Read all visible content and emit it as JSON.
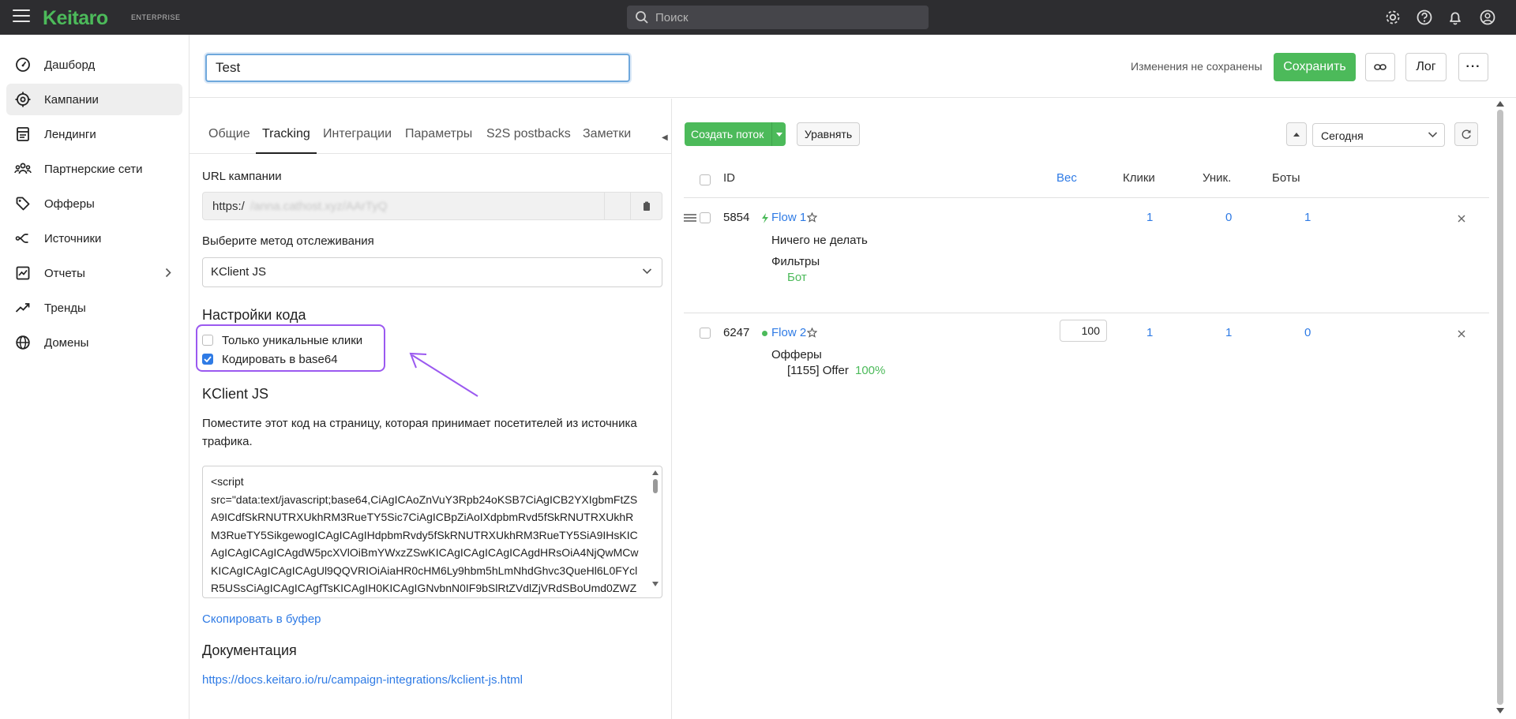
{
  "app": {
    "logo": "Keitaro",
    "edition": "ENTERPRISE",
    "search_placeholder": "Поиск"
  },
  "topbar_icons": [
    "gear-icon",
    "help-icon",
    "bell-icon",
    "user-icon"
  ],
  "sidebar": {
    "items": [
      {
        "label": "Дашборд",
        "icon": "dashboard-icon"
      },
      {
        "label": "Кампании",
        "icon": "target-icon"
      },
      {
        "label": "Лендинги",
        "icon": "landing-icon"
      },
      {
        "label": "Партнерские сети",
        "icon": "partners-icon"
      },
      {
        "label": "Офферы",
        "icon": "tag-icon"
      },
      {
        "label": "Источники",
        "icon": "source-icon"
      },
      {
        "label": "Отчеты",
        "icon": "report-icon"
      },
      {
        "label": "Тренды",
        "icon": "trend-icon"
      },
      {
        "label": "Домены",
        "icon": "globe-icon"
      }
    ]
  },
  "campaign": {
    "name": "Test",
    "unsaved_text": "Изменения не сохранены",
    "save_label": "Сохранить",
    "log_label": "Лог",
    "more_label": "···"
  },
  "tabs": [
    "Общие",
    "Tracking",
    "Интеграции",
    "Параметры",
    "S2S postbacks",
    "Заметки"
  ],
  "tracking": {
    "url_label": "URL кампании",
    "url_prefix": "https:/",
    "url_rest": "/anna.cathost.xyz/AArTyQ",
    "method_label": "Выберите метод отслеживания",
    "method_value": "KClient JS",
    "code_settings_title": "Настройки кода",
    "unique_clicks_label": "Только уникальные клики",
    "unique_clicks_checked": false,
    "base64_label": "Кодировать в base64",
    "base64_checked": true,
    "kclient_title": "KClient JS",
    "description": "Поместите этот код на страницу, которая принимает посетителей из источника трафика.",
    "code": "<script\nsrc=\"data:text/javascript;base64,CiAgICAoZnVuY3Rpb24oKSB7CiAgICB2YXIgbmFtZSA9ICdfSkRNUTRXUkhRM3RueTY5Sic7CiAgICBpZiAoIXdpbmRvd5fSkRNUTRXUkhRM3RueTY5SikgewogICAgICAgIHdpbmRvdy5fSkRNUTRXUkhRM3RueTY5SiA9IHsKICAgICAgICAgICAgdW5pcXVlOiBmYWxzZSwKICAgICAgICAgICAgdHRsOiA4NjQwMCwKICAgICAgICAgICAgUl9QQVRIOiAiaHR0cHM6Ly9hbm5hLmNhdGhvc3QueHl6L0FYclR5USsCiAgICAgICAgfTsKICAgIH0KICAgIGNvbnN0IF9bSlRtZVdlZjVRdSBoUmd0ZWZkD0xbOhVVwTdG9",
    "copy_label": "Скопировать в буфер",
    "docs_title": "Документация",
    "docs_link": "https://docs.keitaro.io/ru/campaign-integrations/kclient-js.html"
  },
  "flows_toolbar": {
    "create_label": "Создать поток",
    "align_label": "Уравнять",
    "date_value": "Сегодня"
  },
  "flows_table": {
    "headers": {
      "id": "ID",
      "weight": "Вес",
      "clicks": "Клики",
      "unique": "Уник.",
      "bots": "Боты"
    },
    "rows": [
      {
        "id": "5854",
        "name": "Flow 1",
        "action": "Ничего не делать",
        "section_title": "Фильтры",
        "section_item": "Бот",
        "weight": "",
        "clicks": "1",
        "unique": "0",
        "bots": "1"
      },
      {
        "id": "6247",
        "name": "Flow 2",
        "section_title": "Офферы",
        "section_item": "[1155] Offer",
        "section_share": "100%",
        "weight": "100",
        "clicks": "1",
        "unique": "1",
        "bots": "0"
      }
    ]
  },
  "colors": {
    "brand_green": "#4cba5a",
    "link_blue": "#2f7be5",
    "annotation_purple": "#9b59f0",
    "topbar": "#2d2d30"
  }
}
